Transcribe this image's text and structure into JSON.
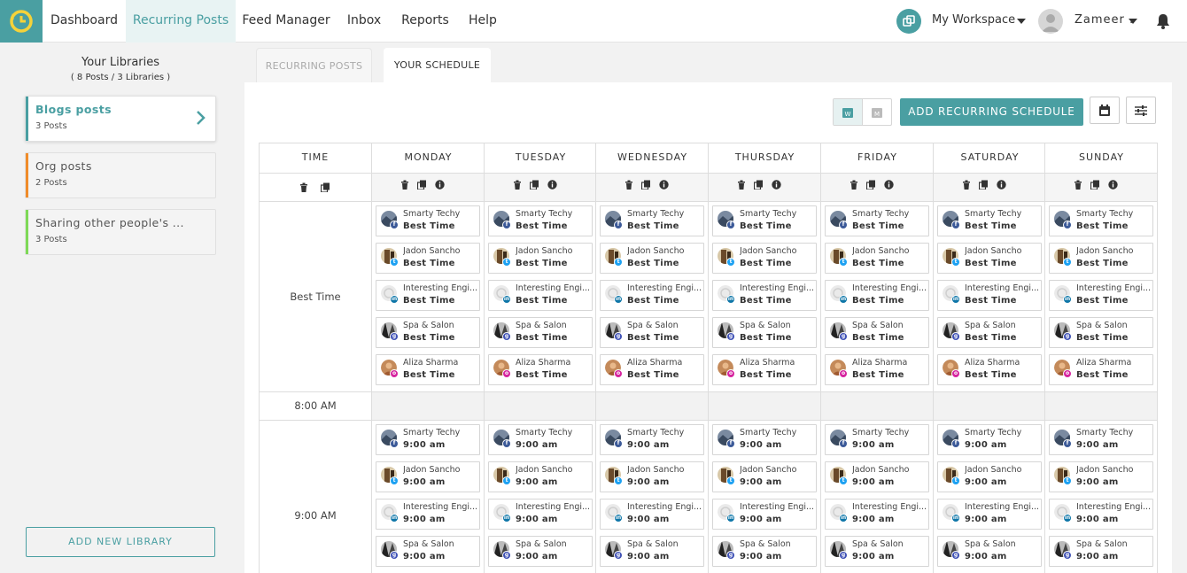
{
  "nav": {
    "items": [
      "Dashboard",
      "Recurring Posts",
      "Feed Manager",
      "Inbox",
      "Reports",
      "Help"
    ],
    "active": "Recurring Posts",
    "workspace": "My Workspace",
    "user": "Zameer ."
  },
  "sidebar": {
    "title": "Your Libraries",
    "subtitle": "( 8 Posts / 3 Libraries )",
    "libraries": [
      {
        "name": "Blogs posts",
        "count": "3 Posts",
        "color": "#4a9fa2",
        "selected": true
      },
      {
        "name": "Org posts",
        "count": "2 Posts",
        "color": "#f08c2a",
        "selected": false
      },
      {
        "name": "Sharing other people's ...",
        "count": "3 Posts",
        "color": "#7ed957",
        "selected": false
      }
    ],
    "add_button": "ADD NEW LIBRARY"
  },
  "tabs": {
    "recurring": "RECURRING POSTS",
    "schedule": "YOUR SCHEDULE"
  },
  "toolbar": {
    "view_week": "W",
    "view_month": "M",
    "add_schedule": "ADD RECURRING SCHEDULE"
  },
  "schedule": {
    "time_header": "TIME",
    "days": [
      "MONDAY",
      "TUESDAY",
      "WEDNESDAY",
      "THURSDAY",
      "FRIDAY",
      "SATURDAY",
      "SUNDAY"
    ],
    "rows": [
      {
        "label": "Best Time",
        "time_text": "Best Time"
      },
      {
        "label": "8:00 AM",
        "time_text": ""
      },
      {
        "label": "9:00 AM",
        "time_text": "9:00 am"
      }
    ],
    "accounts": [
      {
        "name": "Smarty Techy",
        "network": "facebook",
        "net_color": "#3b5998",
        "avatar": "#5a6a80"
      },
      {
        "name": "Jadon Sancho",
        "network": "twitter",
        "net_color": "#1da1f2",
        "avatar": "#8a6a4a"
      },
      {
        "name": "Interesting Engi...",
        "network": "linkedin",
        "net_color": "#0e76a8",
        "avatar": "#e0e0e0"
      },
      {
        "name": "Spa & Salon",
        "network": "google-my-business",
        "net_color": "#3f51b5",
        "avatar": "#4a4a4a"
      },
      {
        "name": "Aliza Sharma",
        "network": "instagram",
        "net_color": "#d6249f",
        "avatar": "#c48a5a"
      }
    ]
  }
}
